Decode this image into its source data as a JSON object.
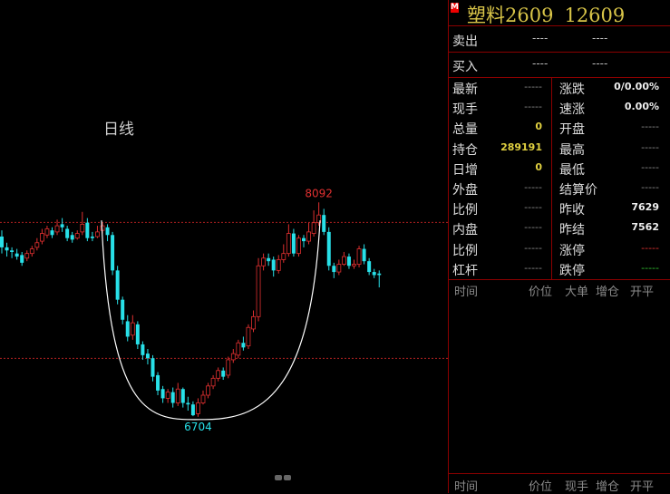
{
  "header": {
    "badge": "M",
    "symbol": "塑料2609",
    "price": "12609"
  },
  "orderbook": [
    {
      "label": "卖出",
      "v1": "----",
      "v2": "----"
    },
    {
      "label": "买入",
      "v1": "----",
      "v2": "----"
    }
  ],
  "stats_left": [
    {
      "label": "最新",
      "value": "-----",
      "style": "dash"
    },
    {
      "label": "现手",
      "value": "-----",
      "style": "dash"
    },
    {
      "label": "总量",
      "value": "0",
      "style": "yel"
    },
    {
      "label": "持仓",
      "value": "289191",
      "style": "yel"
    },
    {
      "label": "日增",
      "value": "0",
      "style": "yel"
    },
    {
      "label": "外盘",
      "value": "-----",
      "style": "dash"
    },
    {
      "label": "比例",
      "value": "-----",
      "style": "dash"
    },
    {
      "label": "内盘",
      "value": "-----",
      "style": "dash"
    },
    {
      "label": "比例",
      "value": "-----",
      "style": "dash"
    },
    {
      "label": "杠杆",
      "value": "-----",
      "style": "dash"
    }
  ],
  "stats_right": [
    {
      "label": "涨跌",
      "value": "0/0.00%",
      "style": "wht"
    },
    {
      "label": "速涨",
      "value": "0.00%",
      "style": "wht"
    },
    {
      "label": "开盘",
      "value": "-----",
      "style": "dash"
    },
    {
      "label": "最高",
      "value": "-----",
      "style": "dash"
    },
    {
      "label": "最低",
      "value": "-----",
      "style": "dash"
    },
    {
      "label": "结算价",
      "value": "-----",
      "style": "dash"
    },
    {
      "label": "昨收",
      "value": "7629",
      "style": "wht"
    },
    {
      "label": "昨结",
      "value": "7562",
      "style": "wht"
    },
    {
      "label": "涨停",
      "value": "-----",
      "style": "red"
    },
    {
      "label": "跌停",
      "value": "-----",
      "style": "grn"
    }
  ],
  "ticks_header": [
    "时间",
    "价位",
    "大单",
    "增仓",
    "开平"
  ],
  "trades_header": [
    "时间",
    "价位",
    "现手",
    "增仓",
    "开平"
  ],
  "chart": {
    "period_label": "日线",
    "high_label": "8092",
    "low_label": "6704",
    "colors": {
      "up": "#e03030",
      "down": "#28e0e8",
      "ref": "#b02020",
      "arc": "#ffffff"
    }
  },
  "chart_data": {
    "type": "candlestick",
    "period": "日线",
    "annotations": [
      {
        "text": "8092",
        "kind": "high"
      },
      {
        "text": "6704",
        "kind": "low"
      }
    ],
    "ylim": [
      6640,
      8170
    ],
    "reference_lines": [
      7962,
      7079
    ],
    "candles": [
      [
        7870,
        7800,
        7910,
        7760
      ],
      [
        7800,
        7780,
        7830,
        7740
      ],
      [
        7780,
        7770,
        7800,
        7730
      ],
      [
        7760,
        7740,
        7790,
        7720
      ],
      [
        7750,
        7700,
        7770,
        7680
      ],
      [
        7730,
        7760,
        7780,
        7710
      ],
      [
        7760,
        7790,
        7810,
        7740
      ],
      [
        7800,
        7830,
        7860,
        7780
      ],
      [
        7840,
        7890,
        7920,
        7820
      ],
      [
        7880,
        7920,
        7940,
        7860
      ],
      [
        7910,
        7880,
        7930,
        7860
      ],
      [
        7900,
        7940,
        7980,
        7880
      ],
      [
        7950,
        7930,
        7990,
        7900
      ],
      [
        7920,
        7860,
        7940,
        7840
      ],
      [
        7880,
        7850,
        7900,
        7830
      ],
      [
        7860,
        7890,
        7910,
        7850
      ],
      [
        7900,
        7950,
        8030,
        7880
      ],
      [
        7960,
        7860,
        7990,
        7840
      ],
      [
        7870,
        7860,
        7900,
        7840
      ],
      [
        7870,
        7900,
        7940,
        7860
      ],
      [
        7910,
        7940,
        7960,
        7890
      ],
      [
        7930,
        7880,
        7950,
        7840
      ],
      [
        7880,
        7650,
        7900,
        7620
      ],
      [
        7650,
        7460,
        7680,
        7430
      ],
      [
        7460,
        7330,
        7480,
        7300
      ],
      [
        7320,
        7220,
        7360,
        7190
      ],
      [
        7230,
        7310,
        7360,
        7200
      ],
      [
        7300,
        7170,
        7320,
        7140
      ],
      [
        7170,
        7100,
        7190,
        7070
      ],
      [
        7110,
        7080,
        7140,
        7040
      ],
      [
        7080,
        6960,
        7100,
        6930
      ],
      [
        6970,
        6870,
        6990,
        6840
      ],
      [
        6880,
        6820,
        6900,
        6790
      ],
      [
        6820,
        6860,
        6880,
        6790
      ],
      [
        6860,
        6790,
        6890,
        6760
      ],
      [
        6790,
        6880,
        6920,
        6770
      ],
      [
        6880,
        6790,
        6890,
        6760
      ],
      [
        6790,
        6780,
        6830,
        6740
      ],
      [
        6780,
        6710,
        6800,
        6704
      ],
      [
        6720,
        6790,
        6820,
        6700
      ],
      [
        6790,
        6840,
        6870,
        6780
      ],
      [
        6840,
        6900,
        6920,
        6820
      ],
      [
        6900,
        6950,
        6970,
        6880
      ],
      [
        6950,
        7000,
        7020,
        6930
      ],
      [
        7000,
        6960,
        7020,
        6940
      ],
      [
        6970,
        7070,
        7090,
        6950
      ],
      [
        7070,
        7110,
        7140,
        7050
      ],
      [
        7100,
        7180,
        7200,
        7080
      ],
      [
        7180,
        7150,
        7220,
        7130
      ],
      [
        7160,
        7280,
        7300,
        7140
      ],
      [
        7270,
        7350,
        7390,
        7250
      ],
      [
        7350,
        7680,
        7730,
        7320
      ],
      [
        7680,
        7730,
        7760,
        7650
      ],
      [
        7730,
        7710,
        7760,
        7680
      ],
      [
        7720,
        7650,
        7740,
        7610
      ],
      [
        7650,
        7720,
        7750,
        7630
      ],
      [
        7720,
        7760,
        7820,
        7700
      ],
      [
        7760,
        7890,
        7950,
        7740
      ],
      [
        7890,
        7760,
        7920,
        7740
      ],
      [
        7760,
        7860,
        7880,
        7740
      ],
      [
        7860,
        7840,
        7880,
        7800
      ],
      [
        7840,
        7900,
        7960,
        7820
      ],
      [
        7890,
        7960,
        8040,
        7870
      ],
      [
        7960,
        8010,
        8092,
        7940
      ],
      [
        8010,
        7900,
        8050,
        7880
      ],
      [
        7900,
        7680,
        7930,
        7650
      ],
      [
        7680,
        7640,
        7700,
        7600
      ],
      [
        7640,
        7690,
        7720,
        7620
      ],
      [
        7690,
        7740,
        7770,
        7680
      ],
      [
        7740,
        7680,
        7760,
        7660
      ],
      [
        7680,
        7690,
        7720,
        7660
      ],
      [
        7690,
        7790,
        7810,
        7670
      ],
      [
        7790,
        7710,
        7820,
        7690
      ],
      [
        7710,
        7640,
        7730,
        7620
      ],
      [
        7640,
        7620,
        7660,
        7600
      ],
      [
        7630,
        7620,
        7650,
        7540
      ]
    ]
  }
}
